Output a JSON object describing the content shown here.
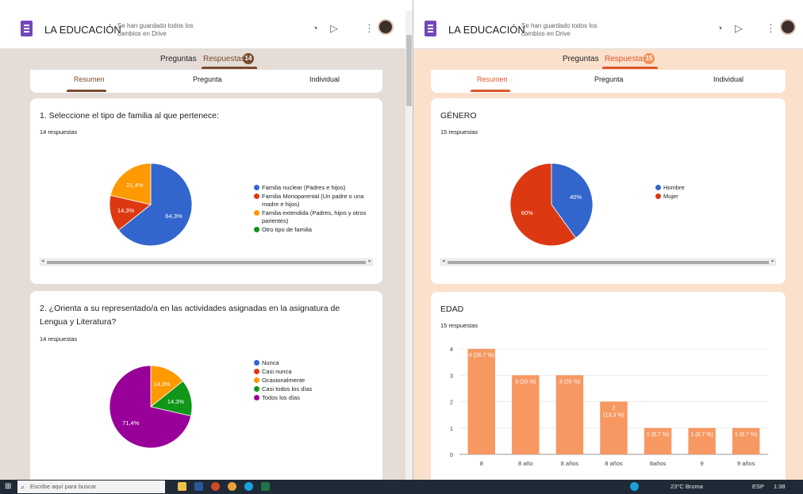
{
  "colors": {
    "purple": "#7248b9",
    "tab": "#7a4b2e",
    "left_bg": "#e4dcd6",
    "right_bg": "#fbe0cc",
    "orange": "#f4925a",
    "blue": "#3366cc",
    "red": "#dc3912",
    "amber": "#ff9900",
    "green": "#109618",
    "magenta": "#990099",
    "bar": "#f79862"
  },
  "left": {
    "app_title": "LA EDUCACIÓN",
    "saved_text": "Se han guardado todos los cambios en Drive",
    "tab_questions": "Preguntas",
    "tab_responses": "Respuestas",
    "badge": "14",
    "subtab_summary": "Resumen",
    "subtab_question": "Pregunta",
    "subtab_individual": "Individual",
    "q1": {
      "title": "1. Seleccione el tipo de familia al que pertenece:",
      "count": "14 respuestas"
    },
    "q2": {
      "title": "2. ¿Orienta a su representado/a en las actividades asignadas en la asignatura de Lengua y Literatura?",
      "count": "14 respuestas"
    }
  },
  "right": {
    "app_title": "LA EDUCACIÓN",
    "saved_text": "Se han guardado todos los cambios en Drive",
    "tab_questions": "Preguntas",
    "tab_responses": "Respuestas",
    "badge": "15",
    "subtab_summary": "Resumen",
    "subtab_question": "Pregunta",
    "subtab_individual": "Individual",
    "q1": {
      "title": "GÉNERO",
      "count": "15 respuestas"
    },
    "q2": {
      "title": "EDAD",
      "count": "15 respuestas"
    }
  },
  "taskbar": {
    "search_placeholder": "Escribe aquí para buscar",
    "weather": "23°C  Bruma",
    "lang": "ESP",
    "time": "1:38"
  },
  "icons": [
    "google-forms-icon",
    "palette-icon",
    "send-icon",
    "more-vert-icon",
    "windows-start-icon",
    "search-icon",
    "file-explorer-icon",
    "word-icon",
    "powerpoint-icon",
    "chrome-icon",
    "edge-icon",
    "excel-icon"
  ],
  "chart_data": [
    {
      "type": "pie",
      "title": "1. Seleccione el tipo de familia al que pertenece:",
      "categories": [
        "Familia nuclear (Padres e hijos)",
        "Familia Monoparental (Un padre o una madre e hijos)",
        "Familia extendida (Padres, hijos y otros parientes)",
        "Otro tipo de familia"
      ],
      "values": [
        64.3,
        14.3,
        21.4,
        0
      ],
      "labels": [
        "64,3%",
        "14,3%",
        "21,4%",
        ""
      ],
      "colors": [
        "#3366cc",
        "#dc3912",
        "#ff9900",
        "#109618"
      ]
    },
    {
      "type": "pie",
      "title": "2. ¿Orienta a su representado/a en las actividades asignadas en la asignatura de Lengua y Literatura?",
      "categories": [
        "Nunca",
        "Casi nunca",
        "Ocasionalmente",
        "Casi todos los días",
        "Todos los días"
      ],
      "values": [
        0,
        0,
        14.3,
        14.3,
        71.4
      ],
      "labels": [
        "",
        "",
        "14,3%",
        "14,3%",
        "71,4%"
      ],
      "colors": [
        "#3366cc",
        "#dc3912",
        "#ff9900",
        "#109618",
        "#990099"
      ]
    },
    {
      "type": "pie",
      "title": "GÉNERO",
      "categories": [
        "Hombre",
        "Mujer"
      ],
      "values": [
        40,
        60
      ],
      "labels": [
        "40%",
        "60%"
      ],
      "colors": [
        "#3366cc",
        "#dc3912"
      ]
    },
    {
      "type": "bar",
      "title": "EDAD",
      "categories": [
        "8",
        "8 año",
        "8 años",
        "8 años",
        "8años",
        "9",
        "9 años"
      ],
      "values": [
        4,
        3,
        3,
        2,
        1,
        1,
        1
      ],
      "labels": [
        "4 (26.7 %)",
        "3 (20 %)",
        "3 (20 %)",
        "2\n(13.3 %)",
        "1 (6.7 %)",
        "1 (6.7 %)",
        "1 (6.7 %)"
      ],
      "yticks": [
        0,
        1,
        2,
        3,
        4
      ],
      "ylim": [
        0,
        4
      ]
    }
  ]
}
